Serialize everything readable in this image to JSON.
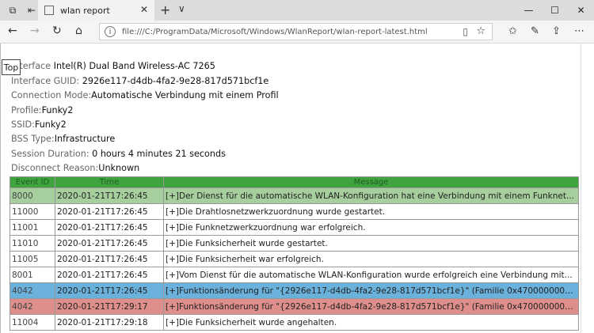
{
  "browser": {
    "tab_title": "wlan report",
    "url": "file:///C:/ProgramData/Microsoft/Windows/WlanReport/wlan-report-latest.html",
    "new_tab_symbol": "+",
    "tab_menu_symbol": "∨"
  },
  "page": {
    "top_button": "Top",
    "details": [
      {
        "label": "Interface",
        "value": "Intel(R) Dual Band Wireless-AC 7265"
      },
      {
        "label": "Interface GUID:",
        "value": "2926e117-d4db-4fa2-9e28-817d571bcf1e"
      },
      {
        "label": "Connection Mode:",
        "value": "Automatische Verbindung mit einem Profil"
      },
      {
        "label": "Profile:",
        "value": "Funky2"
      },
      {
        "label": "SSID:",
        "value": "Funky2"
      },
      {
        "label": "BSS Type:",
        "value": "Infrastructure"
      },
      {
        "label": "Session Duration:",
        "value": "0 hours 4 minutes 21 seconds"
      },
      {
        "label": "Disconnect Reason:",
        "value": "Unknown"
      }
    ],
    "table": {
      "headers": [
        "Event ID",
        "Time",
        "Message"
      ],
      "rows": [
        {
          "id": "8000",
          "time": "2020-01-21T17:26:45",
          "msg": "[+]Der Dienst für die automatische WLAN-Konfiguration hat eine Verbindung mit einem Funknet...",
          "color": "green"
        },
        {
          "id": "11000",
          "time": "2020-01-21T17:26:45",
          "msg": "[+]Die Drahtlosnetzwerkzuordnung wurde gestartet.",
          "color": "white"
        },
        {
          "id": "11001",
          "time": "2020-01-21T17:26:45",
          "msg": "[+]Die Funknetzwerkzuordnung war erfolgreich.",
          "color": "white"
        },
        {
          "id": "11010",
          "time": "2020-01-21T17:26:45",
          "msg": "[+]Die Funksicherheit wurde gestartet.",
          "color": "white"
        },
        {
          "id": "11005",
          "time": "2020-01-21T17:26:45",
          "msg": "[+]Die Funksicherheit war erfolgreich.",
          "color": "white"
        },
        {
          "id": "8001",
          "time": "2020-01-21T17:26:45",
          "msg": "[+]Vom Dienst für die automatische WLAN-Konfiguration wurde erfolgreich eine Verbindung mit...",
          "color": "white"
        },
        {
          "id": "4042",
          "time": "2020-01-21T17:26:45",
          "msg": "[+]Funktionsänderung für \"{2926e117-d4db-4fa2-9e28-817d571bcf1e}\" (Familie 0x470000000000...",
          "color": "blue"
        },
        {
          "id": "4042",
          "time": "2020-01-21T17:29:17",
          "msg": "[+]Funktionsänderung für \"{2926e117-d4db-4fa2-9e28-817d571bcf1e}\" (Familie 0x470000000000...",
          "color": "red"
        },
        {
          "id": "11004",
          "time": "2020-01-21T17:29:18",
          "msg": "[+]Die Funksicherheit wurde angehalten.",
          "color": "white"
        }
      ]
    }
  }
}
